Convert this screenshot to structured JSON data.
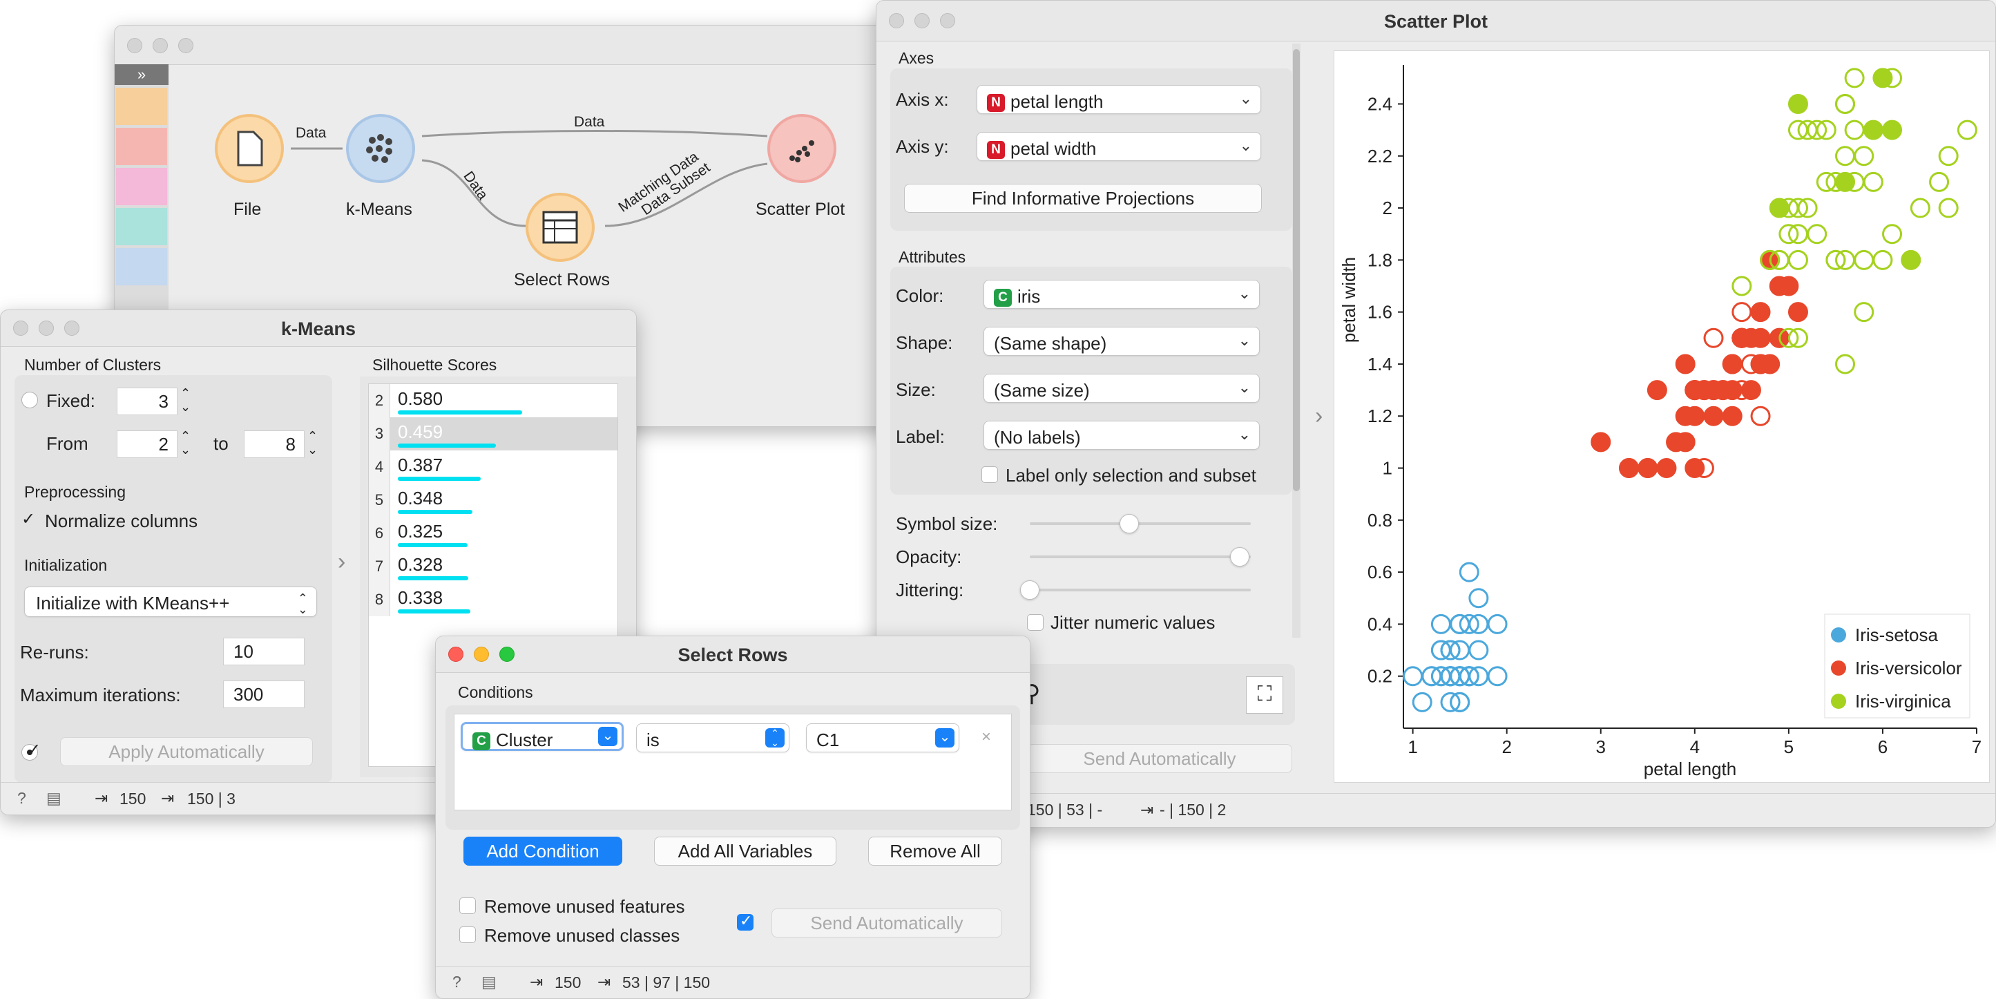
{
  "canvas": {
    "edges": {
      "file_kmeans": "Data",
      "kmeans_scatter": "Data",
      "kmeans_select": "Data",
      "select_scatter_1": "Matching Data",
      "select_scatter_2": "Data Subset"
    },
    "widgets": {
      "file": "File",
      "kmeans": "k-Means",
      "select_rows": "Select Rows",
      "scatter": "Scatter Plot"
    }
  },
  "kmeans": {
    "title": "k-Means",
    "num_clusters_label": "Number of Clusters",
    "fixed_label": "Fixed:",
    "fixed_value": "3",
    "from_label": "From",
    "from_value": "2",
    "to_label": "to",
    "to_value": "8",
    "preprocessing_label": "Preprocessing",
    "normalize_label": "Normalize columns",
    "initialization_label": "Initialization",
    "init_method": "Initialize with KMeans++",
    "reruns_label": "Re-runs:",
    "reruns_value": "10",
    "maxiter_label": "Maximum iterations:",
    "maxiter_value": "300",
    "apply_label": "Apply Automatically",
    "silhouette_label": "Silhouette Scores",
    "scores": [
      {
        "k": "2",
        "score": "0.580",
        "value": 0.58
      },
      {
        "k": "3",
        "score": "0.459",
        "value": 0.459
      },
      {
        "k": "4",
        "score": "0.387",
        "value": 0.387
      },
      {
        "k": "5",
        "score": "0.348",
        "value": 0.348
      },
      {
        "k": "6",
        "score": "0.325",
        "value": 0.325
      },
      {
        "k": "7",
        "score": "0.328",
        "value": 0.328
      },
      {
        "k": "8",
        "score": "0.338",
        "value": 0.338
      }
    ],
    "status_in": "150",
    "status_out": "150 | 3"
  },
  "select_rows": {
    "title": "Select Rows",
    "conditions_label": "Conditions",
    "cond_var": "Cluster",
    "cond_op": "is",
    "cond_val": "C1",
    "add_condition": "Add Condition",
    "add_all": "Add All Variables",
    "remove_all": "Remove All",
    "remove_features": "Remove unused features",
    "remove_classes": "Remove unused classes",
    "send_label": "Send Automatically",
    "status_in": "150",
    "status_out": "53 | 97 | 150"
  },
  "scatter": {
    "title": "Scatter Plot",
    "axes_label": "Axes",
    "axis_x_label": "Axis x:",
    "axis_x": "petal length",
    "axis_y_label": "Axis y:",
    "axis_y": "petal width",
    "find_proj": "Find Informative Projections",
    "attributes_label": "Attributes",
    "color_label": "Color:",
    "color_value": "iris",
    "shape_label": "Shape:",
    "shape_value": "(Same shape)",
    "size_label": "Size:",
    "size_value": "(Same size)",
    "label_label": "Label:",
    "label_value": "(No labels)",
    "label_only": "Label only selection and subset",
    "symbol_size_label": "Symbol size:",
    "symbol_size": 0.45,
    "opacity_label": "Opacity:",
    "opacity": 0.95,
    "jitter_label": "Jittering:",
    "jitter": 0.0,
    "jitter_numeric": "Jitter numeric values",
    "send_label": "Send Automatically",
    "status_in": "150 | 53 | -",
    "status_out": "- | 150 | 2",
    "badge_numeric": "N",
    "badge_categorical": "C"
  },
  "chart_data": {
    "type": "scatter",
    "xlabel": "petal length",
    "ylabel": "petal width",
    "xlim": [
      0.9,
      7.0
    ],
    "ylim": [
      0.0,
      2.55
    ],
    "xticks": [
      "1",
      "2",
      "3",
      "4",
      "5",
      "6",
      "7"
    ],
    "yticks": [
      "0.2",
      "0.4",
      "0.6",
      "0.8",
      "1",
      "1.2",
      "1.4",
      "1.6",
      "1.8",
      "2",
      "2.2",
      "2.4"
    ],
    "legend_position": "bottom-right",
    "series": [
      {
        "name": "Iris-setosa",
        "color": "#4ba8dc",
        "points": [
          [
            1.4,
            0.2
          ],
          [
            1.4,
            0.2
          ],
          [
            1.3,
            0.2
          ],
          [
            1.5,
            0.2
          ],
          [
            1.4,
            0.2
          ],
          [
            1.7,
            0.4
          ],
          [
            1.4,
            0.3
          ],
          [
            1.5,
            0.2
          ],
          [
            1.4,
            0.2
          ],
          [
            1.5,
            0.1
          ],
          [
            1.5,
            0.2
          ],
          [
            1.6,
            0.2
          ],
          [
            1.4,
            0.1
          ],
          [
            1.1,
            0.1
          ],
          [
            1.2,
            0.2
          ],
          [
            1.5,
            0.4
          ],
          [
            1.3,
            0.4
          ],
          [
            1.4,
            0.3
          ],
          [
            1.7,
            0.3
          ],
          [
            1.5,
            0.3
          ],
          [
            1.7,
            0.2
          ],
          [
            1.5,
            0.4
          ],
          [
            1.0,
            0.2
          ],
          [
            1.7,
            0.5
          ],
          [
            1.9,
            0.2
          ],
          [
            1.6,
            0.2
          ],
          [
            1.6,
            0.4
          ],
          [
            1.5,
            0.2
          ],
          [
            1.4,
            0.2
          ],
          [
            1.6,
            0.2
          ],
          [
            1.6,
            0.2
          ],
          [
            1.5,
            0.4
          ],
          [
            1.5,
            0.1
          ],
          [
            1.4,
            0.2
          ],
          [
            1.5,
            0.1
          ],
          [
            1.2,
            0.2
          ],
          [
            1.3,
            0.2
          ],
          [
            1.3,
            0.3
          ],
          [
            1.3,
            0.3
          ],
          [
            1.6,
            0.6
          ],
          [
            1.9,
            0.4
          ],
          [
            1.4,
            0.3
          ],
          [
            1.6,
            0.2
          ],
          [
            1.4,
            0.2
          ],
          [
            1.5,
            0.2
          ],
          [
            1.4,
            0.2
          ]
        ]
      },
      {
        "name": "Iris-versicolor",
        "color": "#e8472b",
        "points": [
          [
            4.7,
            1.4
          ],
          [
            4.5,
            1.5
          ],
          [
            4.9,
            1.5
          ],
          [
            4.0,
            1.3
          ],
          [
            4.6,
            1.5
          ],
          [
            4.5,
            1.3
          ],
          [
            4.7,
            1.6
          ],
          [
            3.3,
            1.0
          ],
          [
            4.6,
            1.3
          ],
          [
            3.9,
            1.4
          ],
          [
            3.5,
            1.0
          ],
          [
            4.2,
            1.5
          ],
          [
            4.0,
            1.0
          ],
          [
            4.7,
            1.4
          ],
          [
            3.6,
            1.3
          ],
          [
            4.4,
            1.4
          ],
          [
            4.5,
            1.5
          ],
          [
            4.1,
            1.0
          ],
          [
            4.5,
            1.5
          ],
          [
            3.9,
            1.1
          ],
          [
            4.8,
            1.8
          ],
          [
            4.0,
            1.3
          ],
          [
            4.9,
            1.5
          ],
          [
            4.7,
            1.2
          ],
          [
            4.3,
            1.3
          ],
          [
            4.4,
            1.4
          ],
          [
            4.8,
            1.4
          ],
          [
            5.0,
            1.7
          ],
          [
            4.5,
            1.5
          ],
          [
            3.5,
            1.0
          ],
          [
            3.8,
            1.1
          ],
          [
            3.7,
            1.0
          ],
          [
            3.9,
            1.2
          ],
          [
            5.1,
            1.6
          ],
          [
            4.5,
            1.5
          ],
          [
            4.5,
            1.6
          ],
          [
            4.7,
            1.5
          ],
          [
            4.4,
            1.3
          ],
          [
            4.1,
            1.3
          ],
          [
            4.0,
            1.3
          ],
          [
            4.4,
            1.2
          ],
          [
            4.6,
            1.4
          ],
          [
            4.0,
            1.2
          ],
          [
            3.3,
            1.0
          ],
          [
            4.2,
            1.3
          ],
          [
            4.2,
            1.2
          ],
          [
            4.2,
            1.3
          ],
          [
            4.3,
            1.3
          ],
          [
            3.0,
            1.1
          ],
          [
            4.1,
            1.3
          ],
          [
            4.9,
            1.7
          ]
        ]
      },
      {
        "name": "Iris-virginica",
        "color": "#a5d21f",
        "points": [
          [
            6.0,
            2.5
          ],
          [
            5.1,
            1.9
          ],
          [
            5.9,
            2.1
          ],
          [
            5.6,
            1.8
          ],
          [
            5.8,
            2.2
          ],
          [
            6.6,
            2.1
          ],
          [
            4.5,
            1.7
          ],
          [
            6.3,
            1.8
          ],
          [
            5.8,
            1.8
          ],
          [
            6.1,
            2.5
          ],
          [
            5.1,
            2.0
          ],
          [
            5.3,
            1.9
          ],
          [
            5.5,
            2.1
          ],
          [
            5.0,
            2.0
          ],
          [
            5.1,
            2.4
          ],
          [
            5.3,
            2.3
          ],
          [
            5.5,
            1.8
          ],
          [
            6.7,
            2.2
          ],
          [
            6.9,
            2.3
          ],
          [
            5.0,
            1.5
          ],
          [
            5.7,
            2.3
          ],
          [
            4.9,
            2.0
          ],
          [
            6.7,
            2.0
          ],
          [
            4.9,
            1.8
          ],
          [
            5.7,
            2.1
          ],
          [
            6.0,
            1.8
          ],
          [
            4.8,
            1.8
          ],
          [
            4.9,
            1.8
          ],
          [
            5.6,
            2.1
          ],
          [
            5.8,
            1.6
          ],
          [
            6.1,
            1.9
          ],
          [
            6.4,
            2.0
          ],
          [
            5.6,
            2.2
          ],
          [
            5.1,
            1.5
          ],
          [
            5.6,
            1.4
          ],
          [
            6.1,
            2.3
          ],
          [
            5.6,
            2.4
          ],
          [
            5.5,
            1.8
          ],
          [
            4.8,
            1.8
          ],
          [
            5.4,
            2.1
          ],
          [
            5.6,
            2.4
          ],
          [
            5.1,
            2.3
          ],
          [
            5.9,
            2.3
          ],
          [
            5.7,
            2.5
          ],
          [
            5.2,
            2.3
          ],
          [
            5.0,
            1.9
          ],
          [
            5.2,
            2.0
          ],
          [
            5.4,
            2.3
          ],
          [
            5.1,
            1.8
          ]
        ]
      }
    ]
  }
}
